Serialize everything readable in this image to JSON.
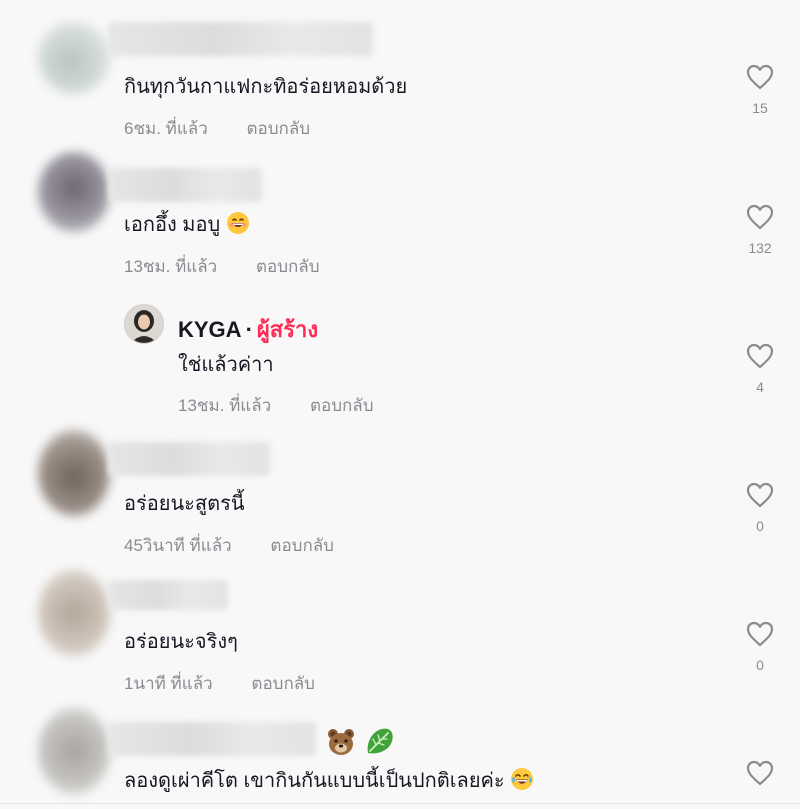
{
  "comments": [
    {
      "text": "กินทุกวันกาแฟกะทิอร่อยหอมด้วย",
      "time": "6ชม. ที่แล้ว",
      "reply_label": "ตอบกลับ",
      "likes": "15",
      "avatar_color": "#c9d3cf"
    },
    {
      "text": "เอกอึ้ง มอบู",
      "time": "13ชม. ที่แล้ว",
      "reply_label": "ตอบกลับ",
      "likes": "132",
      "avatar_color": "#8f8a93"
    },
    {
      "text": "อร่อยนะสูตรนี้",
      "time": "45วินาที ที่แล้ว",
      "reply_label": "ตอบกลับ",
      "likes": "0",
      "avatar_color": "#9a8f86"
    },
    {
      "text": "อร่อยนะจริงๆ",
      "time": "1นาที ที่แล้ว",
      "reply_label": "ตอบกลับ",
      "likes": "0",
      "avatar_color": "#c6bcb1"
    },
    {
      "text": "ลองดูเผ่าคีโต เขากินกันแบบนี้เป็นปกติเลยค่ะ",
      "avatar_color": "#b9b7b4"
    }
  ],
  "reply": {
    "author": "KYGA",
    "separator": "·",
    "creator_label": "ผู้สร้าง",
    "text": "ใช่แล้วค่าา",
    "time": "13ชม. ที่แล้ว",
    "reply_label": "ตอบกลับ",
    "likes": "4"
  },
  "colors": {
    "creator": "#fe2c55",
    "meta": "#8a8b91",
    "text": "#161823"
  },
  "icons": {
    "like": "heart-outline-icon",
    "grin": "grinning-face-emoji",
    "laugh": "tears-of-joy-emoji",
    "bear": "bear-face-emoji",
    "leaf": "leafy-green-emoji"
  }
}
